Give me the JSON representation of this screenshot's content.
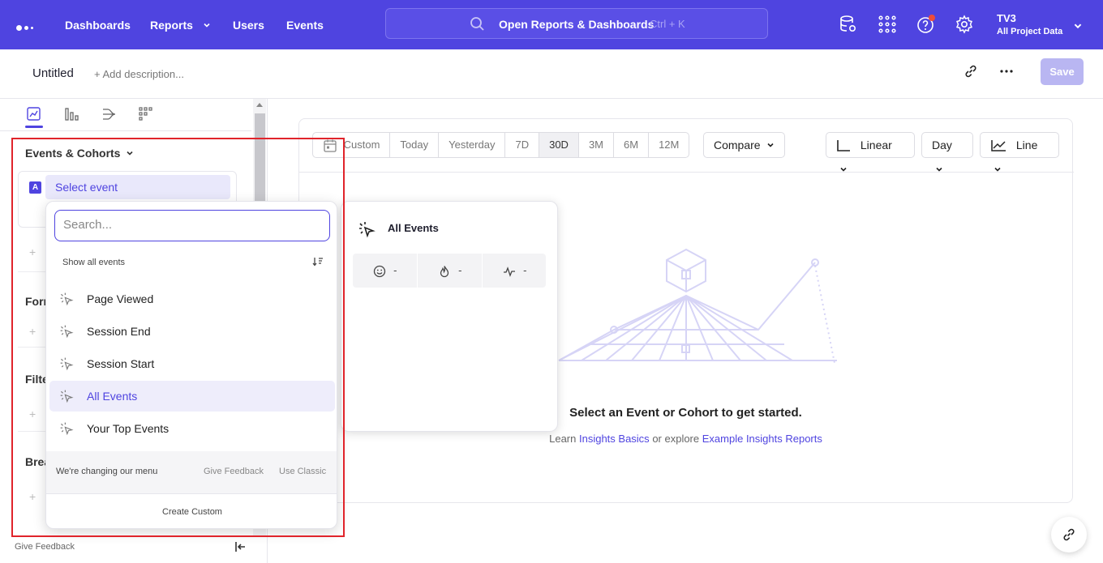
{
  "topnav": {
    "items": [
      "Dashboards",
      "Reports",
      "Users",
      "Events"
    ],
    "search_label": "Open Reports & Dashboards",
    "search_shortcut": "Ctrl + K",
    "project_name": "TV3",
    "project_scope": "All Project Data"
  },
  "report": {
    "title": "Untitled",
    "description_placeholder": "+ Add description...",
    "save_label": "Save"
  },
  "sidebar": {
    "sections": [
      "Events & Cohorts",
      "Form",
      "Filte",
      "Brea"
    ],
    "select_event_badge": "A",
    "select_event_label": "Select event",
    "give_feedback": "Give Feedback"
  },
  "dropdown": {
    "search_placeholder": "Search...",
    "show_all": "Show all events",
    "items": [
      "Page Viewed",
      "Session End",
      "Session Start",
      "All Events",
      "Your Top Events"
    ],
    "footer_note": "We're changing our menu",
    "footer_feedback": "Give Feedback",
    "footer_classic": "Use Classic",
    "create_custom": "Create Custom"
  },
  "preview": {
    "title": "All Events",
    "stats": [
      "-",
      "-",
      "-"
    ]
  },
  "chart_controls": {
    "date_ranges": [
      "Custom",
      "Today",
      "Yesterday",
      "7D",
      "30D",
      "3M",
      "6M",
      "12M"
    ],
    "selected_range": "30D",
    "compare": "Compare",
    "scale": "Linear",
    "interval": "Day",
    "chart_type": "Line"
  },
  "empty_state": {
    "title": "Select an Event or Cohort to get started.",
    "prefix": "Learn",
    "link1": "Insights Basics",
    "middle": "or explore",
    "link2": "Example Insights Reports"
  },
  "colors": {
    "brand": "#4f44e0",
    "highlight": "#e0242b"
  }
}
